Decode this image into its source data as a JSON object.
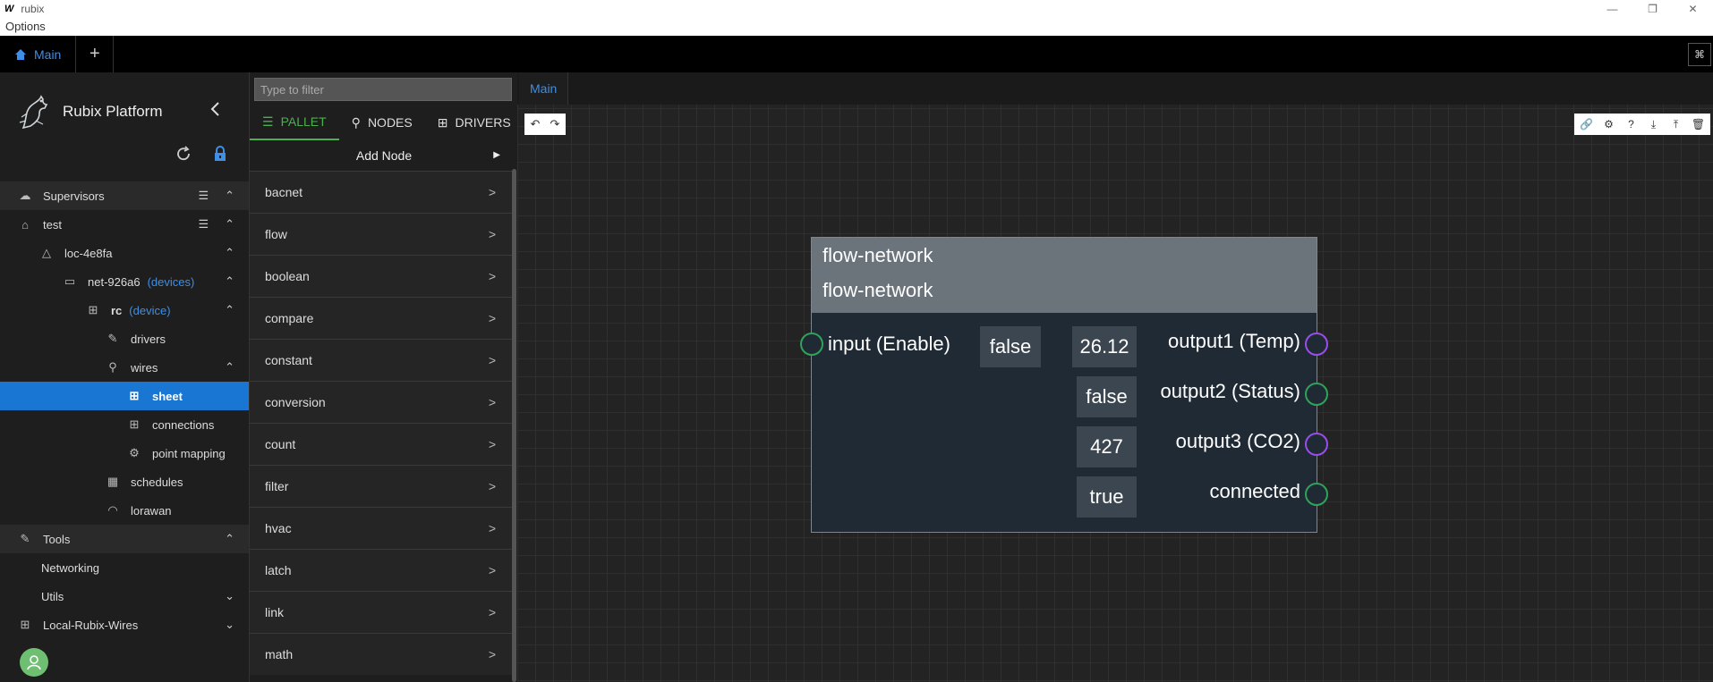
{
  "window": {
    "logo": "W",
    "title": "rubix",
    "menu": "Options",
    "min": "—",
    "restore": "❐",
    "close": "✕"
  },
  "tabbar": {
    "main_label": "Main",
    "plus": "+",
    "right_icon": "⌘"
  },
  "sidebar": {
    "brand": "Rubix Platform",
    "tree": [
      {
        "label": "Supervisors",
        "icon": "☁"
      },
      {
        "label": "test",
        "icon": "⌂"
      },
      {
        "label": "loc-4e8fa",
        "icon": "△"
      },
      {
        "label": "net-926a6",
        "tag": "(devices)",
        "icon": "▭"
      },
      {
        "label": "rc",
        "tag": "(device)",
        "icon": "⊞"
      },
      {
        "label": "drivers",
        "icon": "✎"
      },
      {
        "label": "wires",
        "icon": "⚲"
      },
      {
        "label": "sheet",
        "icon": "⊞"
      },
      {
        "label": "connections",
        "icon": "⊞"
      },
      {
        "label": "point mapping",
        "icon": "⚙"
      },
      {
        "label": "schedules",
        "icon": "▦"
      },
      {
        "label": "lorawan",
        "icon": "◠"
      },
      {
        "label": "Tools",
        "icon": "✎"
      },
      {
        "label": "Networking"
      },
      {
        "label": "Utils"
      },
      {
        "label": "Local-Rubix-Wires",
        "icon": "⊞"
      }
    ]
  },
  "pallet": {
    "filter_placeholder": "Type to filter",
    "tabs": [
      "PALLET",
      "NODES",
      "DRIVERS"
    ],
    "add_node": "Add Node",
    "items": [
      "bacnet",
      "flow",
      "boolean",
      "compare",
      "constant",
      "conversion",
      "count",
      "filter",
      "hvac",
      "latch",
      "link",
      "math"
    ]
  },
  "canvas": {
    "tab_label": "Main"
  },
  "node": {
    "title1": "flow-network",
    "title2": "flow-network",
    "input_label": "input (Enable)",
    "input_value": "false",
    "outputs": [
      {
        "label": "output1 (Temp)",
        "value": "26.12"
      },
      {
        "label": "output2 (Status)",
        "value": "false"
      },
      {
        "label": "output3 (CO2)",
        "value": "427"
      },
      {
        "label": "connected",
        "value": "true"
      }
    ]
  },
  "colors": {
    "accent": "#3d8fe8",
    "selected": "#1976d2",
    "pallet_active": "#4caf50",
    "port_green": "#2fa35a",
    "port_purple": "#9a4de8"
  }
}
